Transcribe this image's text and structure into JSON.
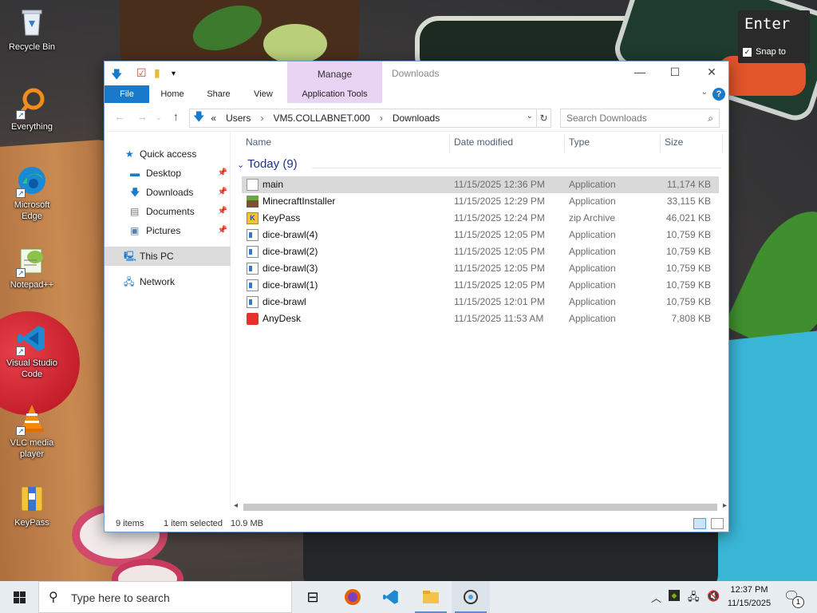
{
  "desktop": {
    "icons": [
      {
        "label": "Recycle Bin",
        "icon": "recycle-bin-icon"
      },
      {
        "label": "Everything",
        "icon": "everything-search-icon"
      },
      {
        "label": "Microsoft Edge",
        "icon": "edge-icon"
      },
      {
        "label": "Notepad++",
        "icon": "notepad-plus-plus-icon"
      },
      {
        "label": "Visual Studio Code",
        "icon": "vscode-icon"
      },
      {
        "label": "VLC media player",
        "icon": "vlc-icon"
      },
      {
        "label": "KeyPass",
        "icon": "keypass-icon"
      }
    ]
  },
  "overlay": {
    "key": "Enter",
    "snap_label": "Snap to"
  },
  "window": {
    "title": "Downloads",
    "manage_tab": "Manage",
    "ribbon_tabs": [
      "File",
      "Home",
      "Share",
      "View",
      "Application Tools"
    ],
    "address": {
      "prefix": "«",
      "segments": [
        "Users",
        "VM5.COLLABNET.000",
        "Downloads"
      ]
    },
    "search_placeholder": "Search Downloads",
    "nav": {
      "quick_access": "Quick access",
      "items": [
        "Desktop",
        "Downloads",
        "Documents",
        "Pictures"
      ],
      "this_pc": "This PC",
      "network": "Network"
    },
    "columns": [
      "Name",
      "Date modified",
      "Type",
      "Size"
    ],
    "group_label": "Today (9)",
    "files": [
      {
        "name": "main",
        "date": "11/15/2025 12:36 PM",
        "type": "Application",
        "size": "11,174 KB",
        "icon": "blank-app-icon",
        "selected": true
      },
      {
        "name": "MinecraftInstaller",
        "date": "11/15/2025 12:29 PM",
        "type": "Application",
        "size": "33,115 KB",
        "icon": "minecraft-icon",
        "selected": false
      },
      {
        "name": "KeyPass",
        "date": "11/15/2025 12:24 PM",
        "type": "zip Archive",
        "size": "46,021 KB",
        "icon": "zip-archive-icon",
        "selected": false
      },
      {
        "name": "dice-brawl(4)",
        "date": "11/15/2025 12:05 PM",
        "type": "Application",
        "size": "10,759 KB",
        "icon": "application-icon",
        "selected": false
      },
      {
        "name": "dice-brawl(2)",
        "date": "11/15/2025 12:05 PM",
        "type": "Application",
        "size": "10,759 KB",
        "icon": "application-icon",
        "selected": false
      },
      {
        "name": "dice-brawl(3)",
        "date": "11/15/2025 12:05 PM",
        "type": "Application",
        "size": "10,759 KB",
        "icon": "application-icon",
        "selected": false
      },
      {
        "name": "dice-brawl(1)",
        "date": "11/15/2025 12:05 PM",
        "type": "Application",
        "size": "10,759 KB",
        "icon": "application-icon",
        "selected": false
      },
      {
        "name": "dice-brawl",
        "date": "11/15/2025 12:01 PM",
        "type": "Application",
        "size": "10,759 KB",
        "icon": "application-icon",
        "selected": false
      },
      {
        "name": "AnyDesk",
        "date": "11/15/2025 11:53 AM",
        "type": "Application",
        "size": "7,808 KB",
        "icon": "anydesk-icon",
        "selected": false
      }
    ],
    "status": {
      "count": "9 items",
      "selection": "1 item selected",
      "size": "10.9 MB"
    }
  },
  "taskbar": {
    "search_placeholder": "Type here to search",
    "apps": [
      "task-view-icon",
      "firefox-icon",
      "vscode-icon",
      "file-explorer-icon",
      "snipping-tool-icon"
    ],
    "time": "12:37 PM",
    "date": "11/15/2025",
    "notification_count": "1"
  },
  "colors": {
    "accent": "#1979ca",
    "manage_tab": "#ead4f3",
    "group_header": "#1e3287",
    "selection": "#d9d9d9"
  }
}
